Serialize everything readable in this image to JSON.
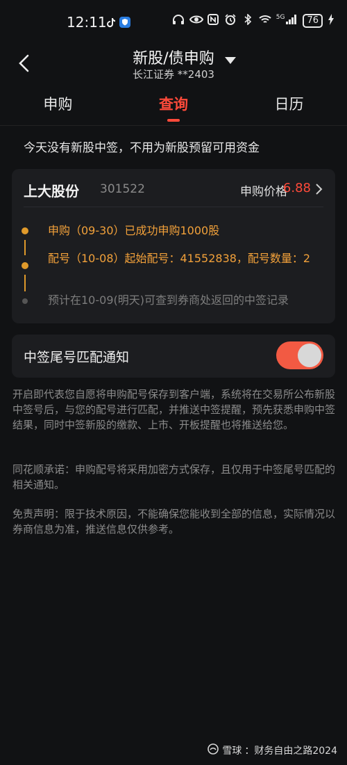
{
  "status_bar": {
    "time": "12:11",
    "network_label": "5G",
    "battery": "76",
    "icons": [
      "tiktok-icon",
      "shield-app-icon",
      "headphones-icon",
      "eye-icon",
      "nfc-icon",
      "alarm-icon",
      "bluetooth-icon",
      "wifi-icon",
      "signal-icon",
      "charging-icon"
    ]
  },
  "header": {
    "title": "新股/债申购",
    "subtitle": "长江证券 **2403"
  },
  "tabs": [
    {
      "label": "申购",
      "active": false
    },
    {
      "label": "查询",
      "active": true
    },
    {
      "label": "日历",
      "active": false
    }
  ],
  "notice": "今天没有新股中签，不用为新股预留可用资金",
  "card": {
    "stock_name": "上大股份",
    "stock_code": "301522",
    "price_label": "申购价格",
    "price_value": "6.88",
    "timeline": [
      {
        "text": "申购（09-30）已成功申购1000股",
        "state": "done"
      },
      {
        "text": "配号（10-08）起始配号：41552838，配号数量：2",
        "state": "done"
      },
      {
        "text": "预计在10-09(明天)可查到券商处返回的中签记录",
        "state": "pending"
      }
    ]
  },
  "toggle": {
    "label": "中签尾号匹配通知",
    "enabled": true
  },
  "info": {
    "p1": "开启即代表您自愿将申购配号保存到客户端，系统将在交易所公布新股中签号后，与您的配号进行匹配，并推送中签提醒，预先获悉申购中签结果，同时中签新股的缴款、上市、开板提醒也将推送给您。",
    "p2": "同花顺承诺：申购配号将采用加密方式保存，且仅用于中签尾号匹配的相关通知。",
    "p3": "免责声明：限于技术原因，不能确保您能收到全部的信息，实际情况以券商信息为准，推送信息仅供参考。"
  },
  "watermark": {
    "brand": "雪球",
    "text": "：财务自由之路2024"
  },
  "colors": {
    "accent_red": "#ff4a3a",
    "timeline_orange": "#f2a13a",
    "switch_on": "#f25a43",
    "background": "#111214",
    "card": "#1c1d20"
  }
}
